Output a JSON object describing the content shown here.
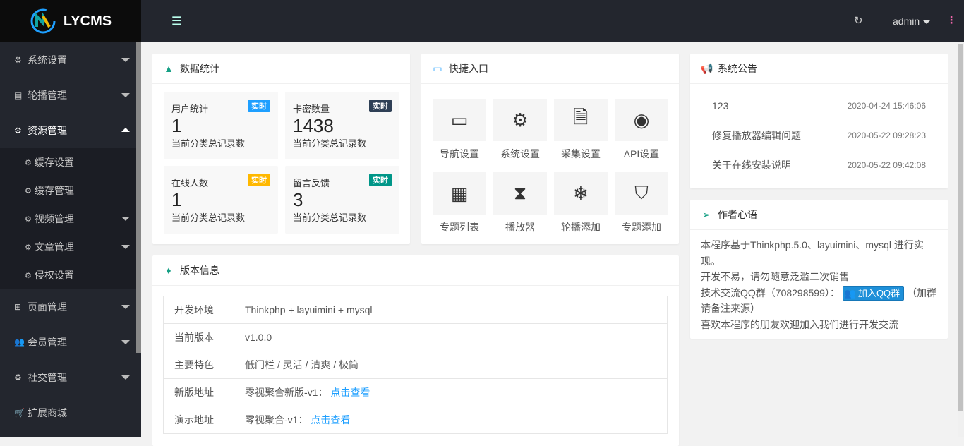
{
  "app": {
    "title": "LYCMS"
  },
  "header": {
    "user": "admin"
  },
  "sidebar": {
    "items": [
      {
        "label": "系统设置",
        "icon": "gear-icon",
        "arrow": "down"
      },
      {
        "label": "轮播管理",
        "icon": "list-icon",
        "arrow": "down"
      },
      {
        "label": "资源管理",
        "icon": "gears-icon",
        "arrow": "up",
        "active": true
      }
    ],
    "sub": [
      {
        "label": "缓存设置"
      },
      {
        "label": "缓存管理"
      },
      {
        "label": "视频管理",
        "arrow": true
      },
      {
        "label": "文章管理",
        "arrow": true
      },
      {
        "label": "侵权设置"
      }
    ],
    "items2": [
      {
        "label": "页面管理",
        "icon": "windows-icon"
      },
      {
        "label": "会员管理",
        "icon": "users-icon"
      },
      {
        "label": "社交管理",
        "icon": "recycle-icon"
      },
      {
        "label": "扩展商城",
        "icon": "cart-icon"
      }
    ]
  },
  "stats": {
    "title": "数据统计",
    "cards": [
      {
        "label": "用户统计",
        "value": "1",
        "badge": "实时",
        "desc": "当前分类总记录数",
        "color": "#1e9fff"
      },
      {
        "label": "卡密数量",
        "value": "1438",
        "badge": "实时",
        "desc": "当前分类总记录数",
        "color": "#2f4056"
      },
      {
        "label": "在线人数",
        "value": "1",
        "badge": "实时",
        "desc": "当前分类总记录数",
        "color": "#ffb800"
      },
      {
        "label": "留言反馈",
        "value": "3",
        "badge": "实时",
        "desc": "当前分类总记录数",
        "color": "#009688"
      }
    ]
  },
  "quick": {
    "title": "快捷入口",
    "items": [
      {
        "label": "导航设置",
        "icon": "window-icon",
        "glyph": "▭"
      },
      {
        "label": "系统设置",
        "icon": "gears-icon",
        "glyph": "⚙"
      },
      {
        "label": "采集设置",
        "icon": "file-icon",
        "glyph": "🗎"
      },
      {
        "label": "API设置",
        "icon": "dot-circle-icon",
        "glyph": "◉"
      },
      {
        "label": "专题列表",
        "icon": "calendar-icon",
        "glyph": "▦"
      },
      {
        "label": "播放器",
        "icon": "hourglass-icon",
        "glyph": "⧗"
      },
      {
        "label": "轮播添加",
        "icon": "snowflake-icon",
        "glyph": "❄"
      },
      {
        "label": "专题添加",
        "icon": "shield-icon",
        "glyph": "⛉"
      }
    ]
  },
  "notice": {
    "title": "系统公告",
    "items": [
      {
        "text": "123",
        "time": "2020-04-24 15:46:06"
      },
      {
        "text": "修复播放器编辑问题",
        "time": "2020-05-22 09:28:23"
      },
      {
        "text": "关于在线安装说明",
        "time": "2020-05-22 09:42:08"
      }
    ]
  },
  "author": {
    "title": "作者心语",
    "line1": "本程序基于Thinkphp.5.0、layuimini、mysql 进行实现。",
    "line2": "开发不易，请勿随意泛滥二次销售",
    "line3a": "技术交流QQ群（708298599）：",
    "qq_button": "加入QQ群",
    "line3b": "（加群请备注来源）",
    "line4": "喜欢本程序的朋友欢迎加入我们进行开发交流"
  },
  "version": {
    "title": "版本信息",
    "rows": [
      {
        "k": "开发环境",
        "v": "Thinkphp + layuimini + mysql"
      },
      {
        "k": "当前版本",
        "v": "v1.0.0"
      },
      {
        "k": "主要特色",
        "v": "低门栏 / 灵活 / 清爽 / 极简"
      },
      {
        "k": "新版地址",
        "v": "零视聚合新版-v1：",
        "link": "点击查看"
      },
      {
        "k": "演示地址",
        "v": "零视聚合-v1：",
        "link": "点击查看"
      }
    ]
  }
}
